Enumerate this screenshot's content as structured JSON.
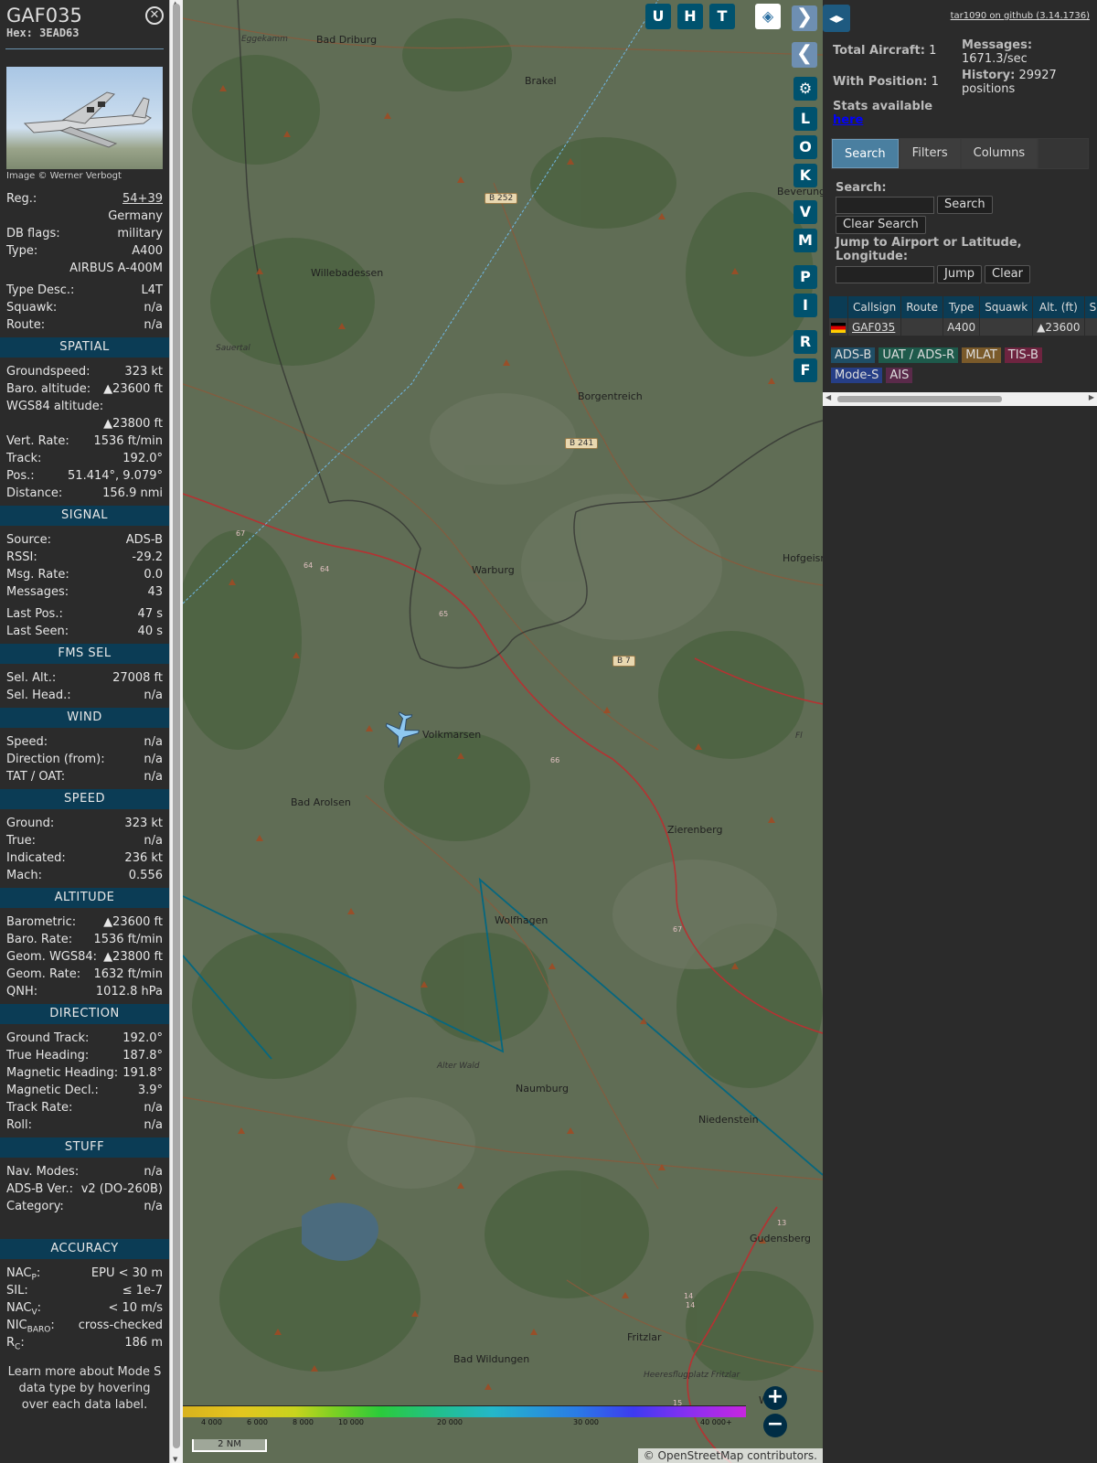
{
  "info": {
    "callsign": "GAF035",
    "hex_label": "Hex:",
    "hex": "3EAD63",
    "photo_credit": "Image © Werner Verbogt",
    "rows_top": [
      {
        "l": "Reg.:",
        "v": "54+39"
      },
      {
        "l": "",
        "v": "Germany"
      },
      {
        "l": "DB flags:",
        "v": "military"
      },
      {
        "l": "Type:",
        "v": "A400"
      },
      {
        "l": "",
        "v": "AIRBUS A-400M"
      }
    ],
    "rows_top2": [
      {
        "l": "Type Desc.:",
        "v": "L4T"
      },
      {
        "l": "Squawk:",
        "v": "n/a"
      },
      {
        "l": "Route:",
        "v": "n/a"
      }
    ],
    "sections": {
      "spatial": "SPATIAL",
      "signal": "SIGNAL",
      "fms": "FMS SEL",
      "wind": "WIND",
      "speed": "SPEED",
      "altitude": "ALTITUDE",
      "direction": "DIRECTION",
      "stuff": "STUFF",
      "accuracy": "ACCURACY"
    },
    "spatial": [
      {
        "l": "Groundspeed:",
        "v": "323 kt"
      },
      {
        "l": "Baro. altitude:",
        "v": "▲23600 ft"
      },
      {
        "l": "WGS84 altitude:",
        "v": ""
      },
      {
        "l": "",
        "v": "▲23800 ft"
      },
      {
        "l": "Vert. Rate:",
        "v": "1536 ft/min"
      },
      {
        "l": "Track:",
        "v": "192.0°"
      },
      {
        "l": "Pos.:",
        "v": "51.414°, 9.079°"
      },
      {
        "l": "Distance:",
        "v": "156.9 nmi"
      }
    ],
    "signal": [
      {
        "l": "Source:",
        "v": "ADS-B"
      },
      {
        "l": "RSSI:",
        "v": "-29.2"
      },
      {
        "l": "Msg. Rate:",
        "v": "0.0"
      },
      {
        "l": "Messages:",
        "v": "43"
      }
    ],
    "signal2": [
      {
        "l": "Last Pos.:",
        "v": "47 s"
      },
      {
        "l": "Last Seen:",
        "v": "40 s"
      }
    ],
    "fms": [
      {
        "l": "Sel. Alt.:",
        "v": "27008 ft"
      },
      {
        "l": "Sel. Head.:",
        "v": "n/a"
      }
    ],
    "wind": [
      {
        "l": "Speed:",
        "v": "n/a"
      },
      {
        "l": "Direction (from):",
        "v": "n/a"
      },
      {
        "l": "TAT / OAT:",
        "v": "n/a"
      }
    ],
    "speed": [
      {
        "l": "Ground:",
        "v": "323 kt"
      },
      {
        "l": "True:",
        "v": "n/a"
      },
      {
        "l": "Indicated:",
        "v": "236 kt"
      },
      {
        "l": "Mach:",
        "v": "0.556"
      }
    ],
    "altitude": [
      {
        "l": "Barometric:",
        "v": "▲23600 ft"
      },
      {
        "l": "Baro. Rate:",
        "v": "1536 ft/min"
      },
      {
        "l": "Geom. WGS84:",
        "v": "▲23800 ft"
      },
      {
        "l": "Geom. Rate:",
        "v": "1632 ft/min"
      },
      {
        "l": "QNH:",
        "v": "1012.8 hPa"
      }
    ],
    "direction": [
      {
        "l": "Ground Track:",
        "v": "192.0°"
      },
      {
        "l": "True Heading:",
        "v": "187.8°"
      },
      {
        "l": "Magnetic Heading:",
        "v": "191.8°"
      },
      {
        "l": "Magnetic Decl.:",
        "v": "3.9°"
      },
      {
        "l": "Track Rate:",
        "v": "n/a"
      },
      {
        "l": "Roll:",
        "v": "n/a"
      }
    ],
    "stuff": [
      {
        "l": "Nav. Modes:",
        "v": "n/a"
      },
      {
        "l": "ADS-B Ver.:",
        "v": "v2 (DO-260B)"
      },
      {
        "l": "Category:",
        "v": "n/a"
      }
    ],
    "accuracy": {
      "nacp_l": "NAC",
      "nacp_sub": "P",
      "nacp_v": "EPU < 30 m",
      "sil_l": "SIL:",
      "sil_v": "≤ 1e-7",
      "nacv_l": "NAC",
      "nacv_sub": "V",
      "nacv_v": "< 10 m/s",
      "nicb_l": "NIC",
      "nicb_sub": "BARO",
      "nicb_v": "cross-checked",
      "rc_l": "R",
      "rc_sub": "C",
      "rc_v": "186 m"
    },
    "learn_more": "Learn more about Mode S data type by hovering over each data label."
  },
  "map": {
    "buttons": {
      "u": "U",
      "h": "H",
      "t": "T",
      "l": "L",
      "o": "O",
      "k": "K",
      "v": "V",
      "m": "M",
      "p": "P",
      "i": "I",
      "r": "R",
      "f": "F"
    },
    "places": [
      {
        "n": "Bad Driburg"
      },
      {
        "n": "Brakel"
      },
      {
        "n": "Willebadessen"
      },
      {
        "n": "Borgentreich"
      },
      {
        "n": "Warburg"
      },
      {
        "n": "Hofgeisn"
      },
      {
        "n": "Volkmarsen"
      },
      {
        "n": "Bad Arolsen"
      },
      {
        "n": "Zierenberg"
      },
      {
        "n": "Wolfhagen"
      },
      {
        "n": "Naumburg"
      },
      {
        "n": "Niedenstein"
      },
      {
        "n": "Gudensberg"
      },
      {
        "n": "Fritzlar"
      },
      {
        "n": "Bad Wildungen"
      },
      {
        "n": "Beverung"
      },
      {
        "n": "Wa"
      }
    ],
    "places_italic": [
      {
        "n": "Eggekamm"
      },
      {
        "n": "Sauertal"
      },
      {
        "n": "Alter Wald"
      },
      {
        "n": "Heeresflugplatz Fritzlar"
      },
      {
        "n": "Fl"
      }
    ],
    "shields": [
      "B 252",
      "B 241",
      "B 7"
    ],
    "road_numbers": [
      "67",
      "64",
      "64",
      "65",
      "66",
      "67",
      "13",
      "14",
      "14",
      "15"
    ],
    "zoom_in": "+",
    "zoom_out": "−",
    "altitude_ticks": [
      "4 000",
      "6 000",
      "8 000",
      "10 000",
      "20 000",
      "30 000",
      "40 000+"
    ],
    "scale": "2 NM",
    "attribution": "© OpenStreetMap contributors."
  },
  "sidebar": {
    "toggle": "◂▸",
    "github": "tar1090 on github (3.14.1736)",
    "total_aircraft_label": "Total Aircraft:",
    "total_aircraft": "1",
    "with_position_label": "With Position:",
    "with_position": "1",
    "messages_label": "Messages:",
    "messages": "1671.3/sec",
    "history_label": "History:",
    "history": "29927 positions",
    "stats_label": "Stats available",
    "stats_link": "here",
    "tabs": [
      "Search",
      "Filters",
      "Columns"
    ],
    "search_label": "Search:",
    "search_btn": "Search",
    "clear_search_btn": "Clear Search",
    "jump_label": "Jump to Airport or Latitude, Longitude:",
    "jump_btn": "Jump",
    "clear_btn": "Clear",
    "columns": [
      "Callsign",
      "Route",
      "Type",
      "Squawk",
      "Alt. (ft)",
      "Spd"
    ],
    "row": {
      "callsign": "GAF035",
      "route": "",
      "type": "A400",
      "squawk": "",
      "alt": "▲23600",
      "spd": ""
    },
    "legend": [
      {
        "label": "ADS-B",
        "color": "#1f4e66"
      },
      {
        "label": "UAT / ADS-R",
        "color": "#1e5a4b"
      },
      {
        "label": "MLAT",
        "color": "#7a5a2a"
      },
      {
        "label": "TIS-B",
        "color": "#6e2440"
      },
      {
        "label": "Mode-S",
        "color": "#263e86"
      },
      {
        "label": "AIS",
        "color": "#5a2a4a"
      }
    ]
  }
}
